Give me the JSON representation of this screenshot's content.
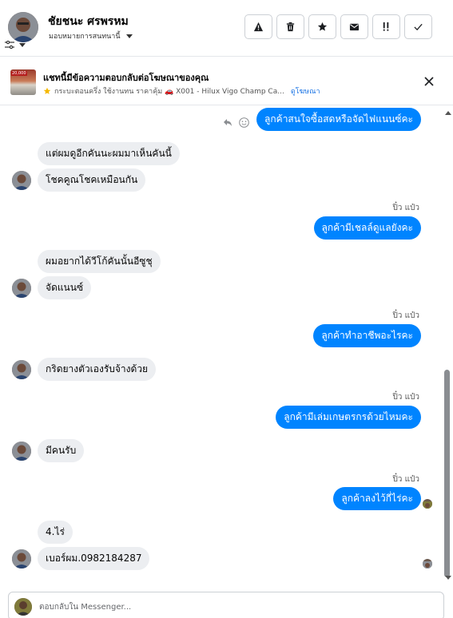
{
  "header": {
    "name": "ชัยชนะ ศรพรหม",
    "assign_label": "มอบหมายการสนทนานี้",
    "actions": [
      "report-icon",
      "trash-icon",
      "star-icon",
      "mail-icon",
      "mark-spam-icon",
      "done-icon"
    ]
  },
  "ad": {
    "title": "แชทนี้มีข้อความตอบกลับต่อโฆษณาของคุณ",
    "thumb_tag": "20,000",
    "meta": "กระบะตอนครึ่ง ใช้งานทน ราคาคุ้ม 🚗 X001 - Hilux Vigo Champ Ca...",
    "link": "ดูโฆษณา"
  },
  "messages": {
    "m1": "ลูกค้าสนใจซื้อสดหรือจัดไฟแนนซ์คะ",
    "m2": "แต่ผมดูอีกคันนะผมมาเห็นคันนี้",
    "m3": "โชคคูณโชคเหมือนกัน",
    "sender1": "ปิ๋ว แป๋ว",
    "m4": "ลูกค้ามีเชลล์ดูแลยังคะ",
    "m5": "ผมอยากได้วีโก้คันนั้นอีซูชุ",
    "m6": "จัดแนนซ์",
    "sender2": "ปิ๋ว แป๋ว",
    "m7": "ลูกค้าทำอาชีพอะไรคะ",
    "m8": "กริดยางตัวเองรับจ้างด้วย",
    "sender3": "ปิ๋ว แป๋ว",
    "m9": "ลูกค้ามีเล่มเกษตรกรด้วยไหมคะ",
    "m10": "มีคนรับ",
    "sender4": "ปิ๋ว แป๋ว",
    "m11": "ลูกค้าลงไว้กี่ไร่คะ",
    "m12": "4.ไร่",
    "m13": "เบอร์ผม.0982184287"
  },
  "reply": {
    "placeholder": "ตอบกลับใน Messenger..."
  },
  "colors": {
    "outgoing": "#0084ff",
    "incoming": "#eceef1",
    "link": "#1b74e4"
  }
}
